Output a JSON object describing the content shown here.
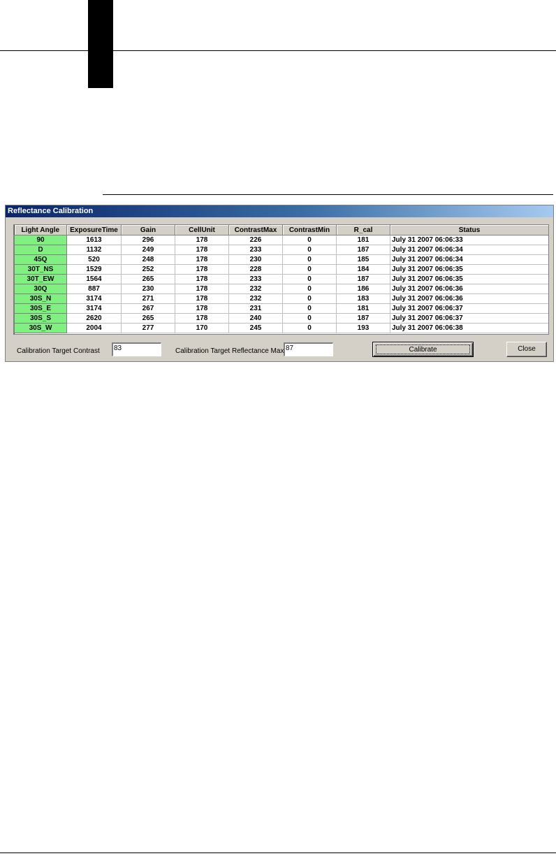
{
  "dialog": {
    "title": "Reflectance Calibration"
  },
  "table": {
    "columns": [
      "Light Angle",
      "ExposureTime",
      "Gain",
      "CellUnit",
      "ContrastMax",
      "ContrastMin",
      "R_cal",
      "Status"
    ],
    "rows": [
      [
        "90",
        "1613",
        "296",
        "178",
        "226",
        "0",
        "181",
        "July 31 2007  06:06:33"
      ],
      [
        "D",
        "1132",
        "249",
        "178",
        "233",
        "0",
        "187",
        "July 31 2007  06:06:34"
      ],
      [
        "45Q",
        "520",
        "248",
        "178",
        "230",
        "0",
        "185",
        "July 31 2007  06:06:34"
      ],
      [
        "30T_NS",
        "1529",
        "252",
        "178",
        "228",
        "0",
        "184",
        "July 31 2007  06:06:35"
      ],
      [
        "30T_EW",
        "1564",
        "265",
        "178",
        "233",
        "0",
        "187",
        "July 31 2007  06:06:35"
      ],
      [
        "30Q",
        "887",
        "230",
        "178",
        "232",
        "0",
        "186",
        "July 31 2007  06:06:36"
      ],
      [
        "30S_N",
        "3174",
        "271",
        "178",
        "232",
        "0",
        "183",
        "July 31 2007  06:06:36"
      ],
      [
        "30S_E",
        "3174",
        "267",
        "178",
        "231",
        "0",
        "181",
        "July 31 2007  06:06:37"
      ],
      [
        "30S_S",
        "2620",
        "265",
        "178",
        "240",
        "0",
        "187",
        "July 31 2007  06:06:37"
      ],
      [
        "30S_W",
        "2004",
        "277",
        "170",
        "245",
        "0",
        "193",
        "July 31 2007  06:06:38"
      ]
    ]
  },
  "form": {
    "contrast_label": "Calibration Target Contrast",
    "contrast_value": "83",
    "reflectance_label": "Calibration Target Reflectance Max",
    "reflectance_value": "87",
    "calibrate_label": "Calibrate",
    "close_label": "Close"
  },
  "colors": {
    "angle_cell": "#80f080",
    "titlebar_start": "#0a246a",
    "titlebar_end": "#a6caf0",
    "dialog_bg": "#d4d0c8"
  }
}
